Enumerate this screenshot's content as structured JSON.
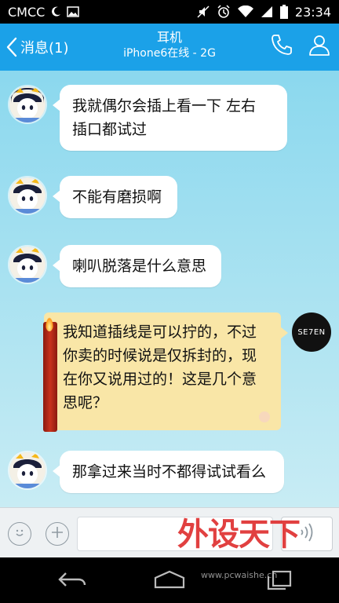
{
  "status_bar": {
    "carrier": "CMCC",
    "time": "23:34"
  },
  "header": {
    "back_label": "消息(1)",
    "title": "耳机",
    "subtitle": "iPhone6在线 - 2G"
  },
  "messages": [
    {
      "side": "left",
      "text_line1": "我就偶尔会插上看一下 左右",
      "text_line2": "插口都试过"
    },
    {
      "side": "left",
      "text": "不能有磨损啊"
    },
    {
      "side": "left",
      "text": "喇叭脱落是什么意思"
    },
    {
      "side": "right",
      "text_line1": "我知道插线是可以拧的，不过",
      "text_line2": "你卖的时候说是仅拆封的，现",
      "text_line3": "在你又说用过的！这是几个意",
      "text_line4": "思呢？"
    },
    {
      "side": "left",
      "text": "那拿过来当时不都得试试看么"
    }
  ],
  "self_avatar_label": "SE7EN",
  "watermark": {
    "text": "外设天下",
    "url": "www.pcwaishe.cn"
  },
  "colors": {
    "accent": "#1ba1e8",
    "right_bubble": "#f9e6a7"
  }
}
